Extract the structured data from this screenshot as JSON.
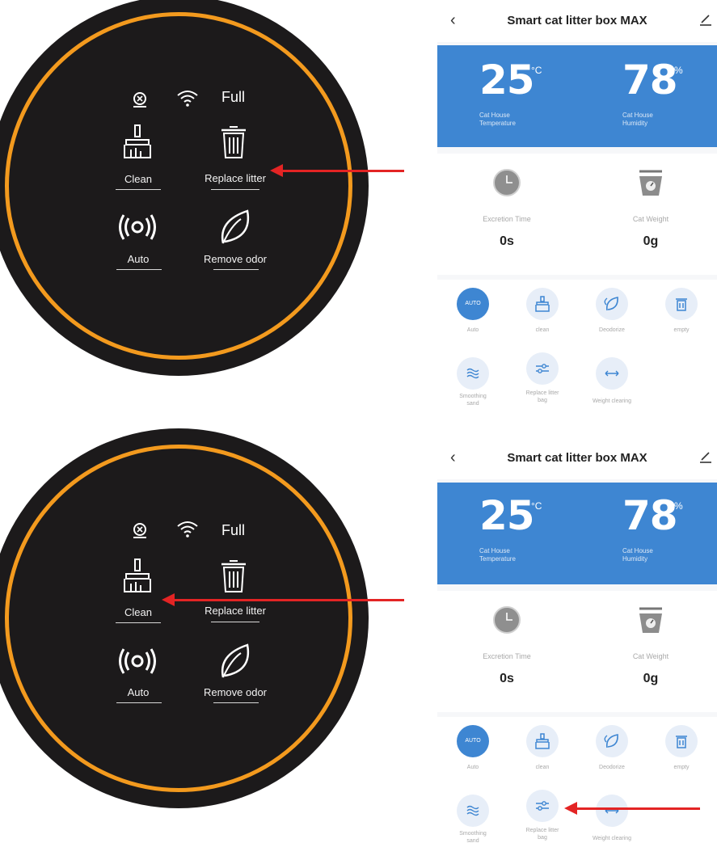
{
  "panel": {
    "status_full": "Full",
    "clean": "Clean",
    "replace_litter": "Replace litter",
    "auto": "Auto",
    "remove_odor": "Remove odor"
  },
  "app": {
    "title": "Smart cat litter box MAX",
    "temperature": "25",
    "temperature_unit": "°C",
    "temperature_caption_1": "Cat House",
    "temperature_caption_2": "Temperature",
    "humidity": "78",
    "humidity_unit": "%",
    "humidity_caption_1": "Cat House",
    "humidity_caption_2": "Humidity",
    "excretion_label": "Excretion Time",
    "excretion_value": "0s",
    "weight_label": "Cat Weight",
    "weight_value": "0g",
    "modes": {
      "auto": "Auto",
      "auto_badge": "AUTO",
      "clean": "clean",
      "deodorize": "Deodorize",
      "empty": "empty",
      "smoothing_1": "Smoothing",
      "smoothing_2": "sand",
      "replace_bag_1": "Replace litter",
      "replace_bag_2": "bag",
      "weight_clearing": "Weight clearing"
    }
  },
  "colors": {
    "ring": "#f39a1e",
    "panel": "#1c1a1b",
    "banner": "#3e86d2",
    "arrow": "#e32424"
  }
}
